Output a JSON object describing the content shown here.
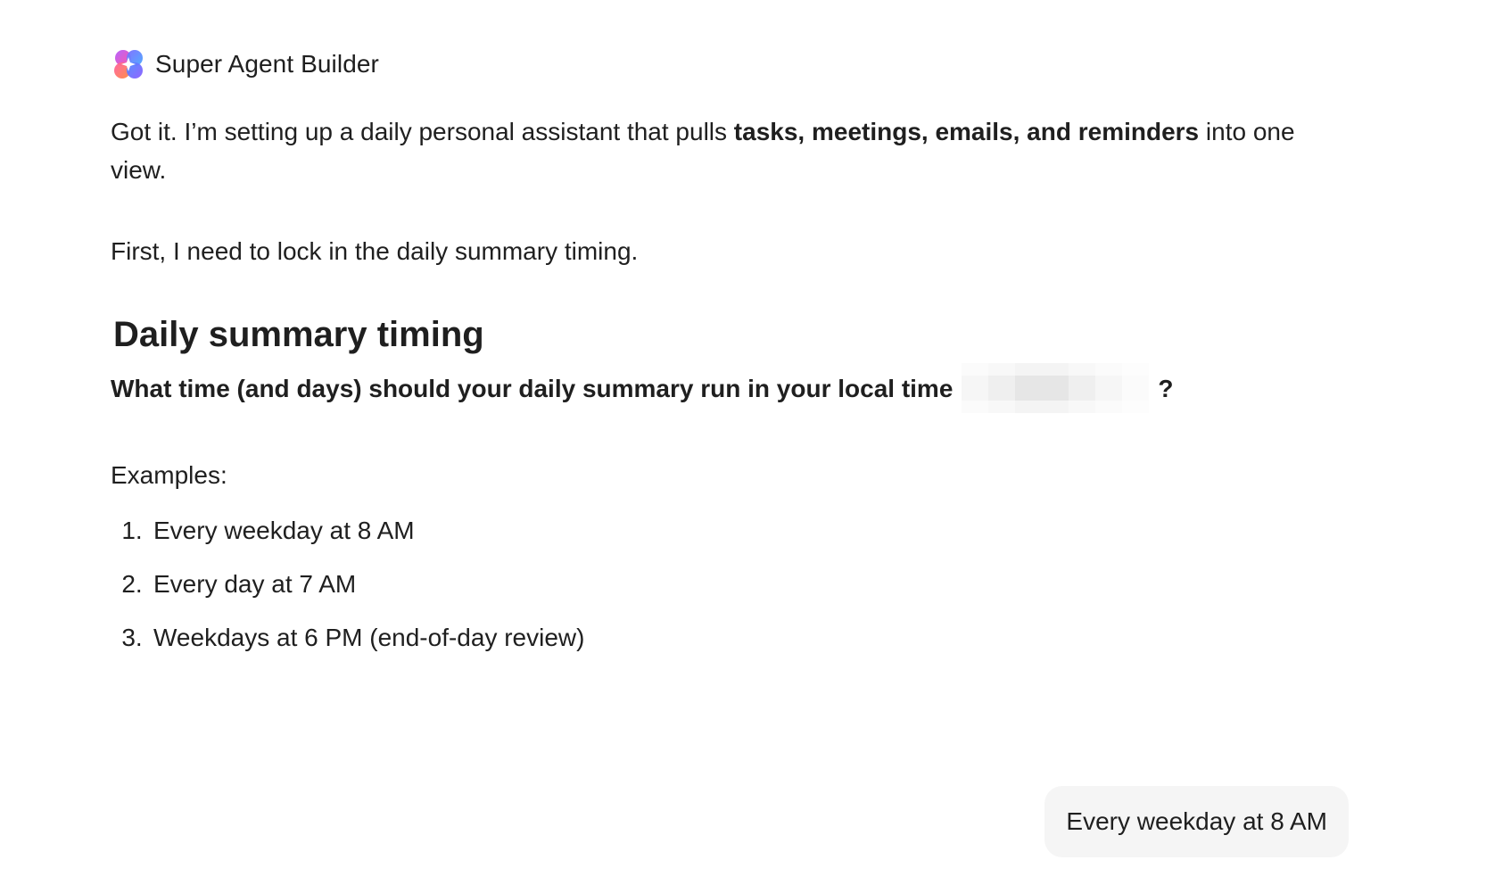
{
  "agent": {
    "name": "Super Agent Builder",
    "logo_icon": "multicolor-flower-logo-icon"
  },
  "message": {
    "intro_before": "Got it. I’m setting up a daily personal assistant that pulls ",
    "intro_bold": "tasks, meetings, emails, and reminders",
    "intro_after": " into one view.",
    "lock_in": "First, I need to lock in the daily summary timing.",
    "heading": "Daily summary timing",
    "question_text": "What time (and days) should your daily summary run in your local time",
    "question_mark": "?",
    "examples_label": "Examples:",
    "examples": [
      {
        "num": "1.",
        "text": "Every weekday at 8 AM"
      },
      {
        "num": "2.",
        "text": "Every day at 7 AM"
      },
      {
        "num": "3.",
        "text": "Weekdays at 6 PM (end-of-day review)"
      }
    ]
  },
  "user_reply": {
    "text": "Every weekday at 8 AM"
  },
  "colors": {
    "text": "#1f1f1f",
    "bubble_bg": "#f5f5f5"
  }
}
